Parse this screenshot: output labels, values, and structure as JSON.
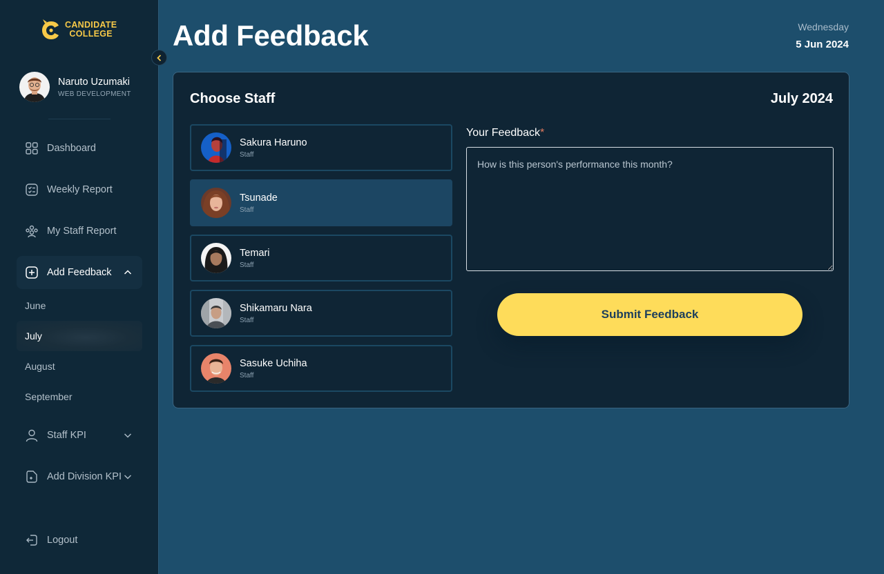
{
  "brand": {
    "line1": "CANDIDATE",
    "line2": "COLLEGE",
    "color": "#f7c948"
  },
  "user": {
    "name": "Naruto Uzumaki",
    "role": "WEB DEVELOPMENT"
  },
  "nav": {
    "dashboard": "Dashboard",
    "weekly_report": "Weekly Report",
    "my_staff_report": "My Staff Report",
    "add_feedback": "Add Feedback",
    "feedback_months": [
      "June",
      "July",
      "August",
      "September"
    ],
    "current_month": "July",
    "staff_kpi": "Staff KPI",
    "add_division_kpi": "Add Division KPI",
    "logout": "Logout"
  },
  "header": {
    "title": "Add Feedback",
    "day": "Wednesday",
    "date": "5 Jun 2024"
  },
  "card": {
    "title": "Choose Staff",
    "month": "July 2024"
  },
  "staff": [
    {
      "name": "Sakura Haruno",
      "role": "Staff",
      "selected": false
    },
    {
      "name": "Tsunade",
      "role": "Staff",
      "selected": true
    },
    {
      "name": "Temari",
      "role": "Staff",
      "selected": false
    },
    {
      "name": "Shikamaru Nara",
      "role": "Staff",
      "selected": false
    },
    {
      "name": "Sasuke Uchiha",
      "role": "Staff",
      "selected": false
    }
  ],
  "feedback": {
    "label": "Your Feedback",
    "required_mark": "*",
    "value": "",
    "placeholder": "How is this person's performance this month?",
    "submit_label": "Submit Feedback"
  },
  "colors": {
    "background": "#1d4e6c",
    "sidebar": "#0f2838",
    "card": "#0f2535",
    "selected_staff": "#1c4663",
    "accent_button": "#fedc5a"
  }
}
